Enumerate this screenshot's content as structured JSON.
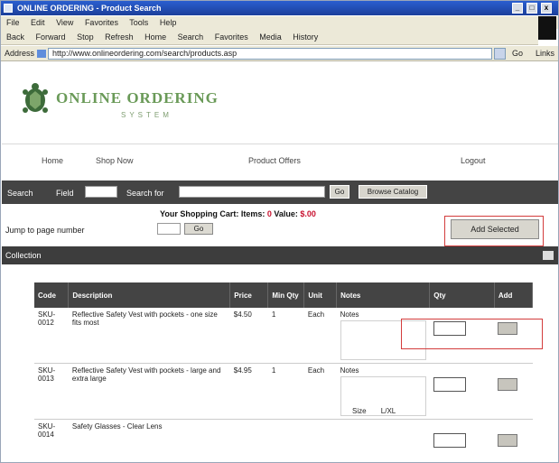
{
  "window": {
    "title": "ONLINE ORDERING - Product Search"
  },
  "menu": [
    "File",
    "Edit",
    "View",
    "Favorites",
    "Tools",
    "Help"
  ],
  "toolbar": [
    "Back",
    "Forward",
    "Stop",
    "Refresh",
    "Home",
    "Search",
    "Favorites",
    "Media",
    "History"
  ],
  "address": {
    "label": "Address",
    "url": "http://www.onlineordering.com/search/products.asp",
    "go": "Go",
    "links": "Links"
  },
  "header": {
    "brand": "ONLINE ORDERING",
    "tagline": "SYSTEM"
  },
  "nav": {
    "home": "Home",
    "shop": "Shop Now",
    "account": "Product Offers",
    "logout": "Logout"
  },
  "search": {
    "label1": "Search",
    "label2": "Field",
    "label3": "Search for",
    "go": "Go",
    "adv": "Browse Catalog"
  },
  "summary": {
    "text": "Your Shopping Cart: Items:",
    "items": "0",
    "value_label": "Value:",
    "value": "$.00"
  },
  "paging": {
    "label": "Jump to page number",
    "go": "Go"
  },
  "add_button": "Add Selected",
  "collection_label": "Collection",
  "table": {
    "headers": [
      "Code",
      "Description",
      "Price",
      "Min Qty",
      "Unit",
      "Notes",
      "Qty",
      "Add"
    ],
    "rows": [
      {
        "code": "SKU-0012",
        "desc": "Reflective Safety Vest with pockets - one size fits most",
        "price": "$4.50",
        "min": "1",
        "unit": "Each"
      },
      {
        "code": "SKU-0013",
        "desc": "Reflective Safety Vest with pockets - large and extra large",
        "price": "$4.95",
        "min": "1",
        "unit": "Each"
      },
      {
        "code": "SKU-0014",
        "desc": "Safety Glasses - Clear Lens",
        "price": "",
        "min": "",
        "unit": ""
      }
    ],
    "notes_label": "Notes",
    "extra_label": "Size",
    "extra_value": "L/XL"
  }
}
